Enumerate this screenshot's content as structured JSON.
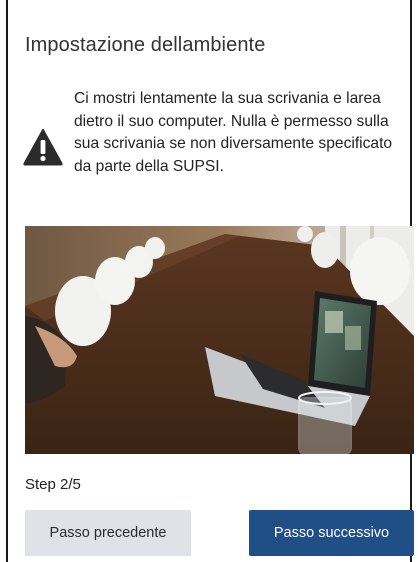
{
  "setup": {
    "title": "Impostazione dellambiente",
    "warning_text": "Ci mostri lentamente la sua scrivania e larea dietro il suo computer. Nulla è permesso sulla sua scrivania se non diversamente specificato da parte della SUPSI."
  },
  "video": {
    "description_icon": "desk-camera-preview"
  },
  "progress": {
    "label": "Step 2/5",
    "current": 2,
    "total": 5
  },
  "buttons": {
    "prev_label": "Passo precedente",
    "next_label": "Passo successivo"
  },
  "colors": {
    "primary": "#204e87",
    "secondary": "#dfe3e7",
    "warning_icon": "#2b2b2b"
  }
}
